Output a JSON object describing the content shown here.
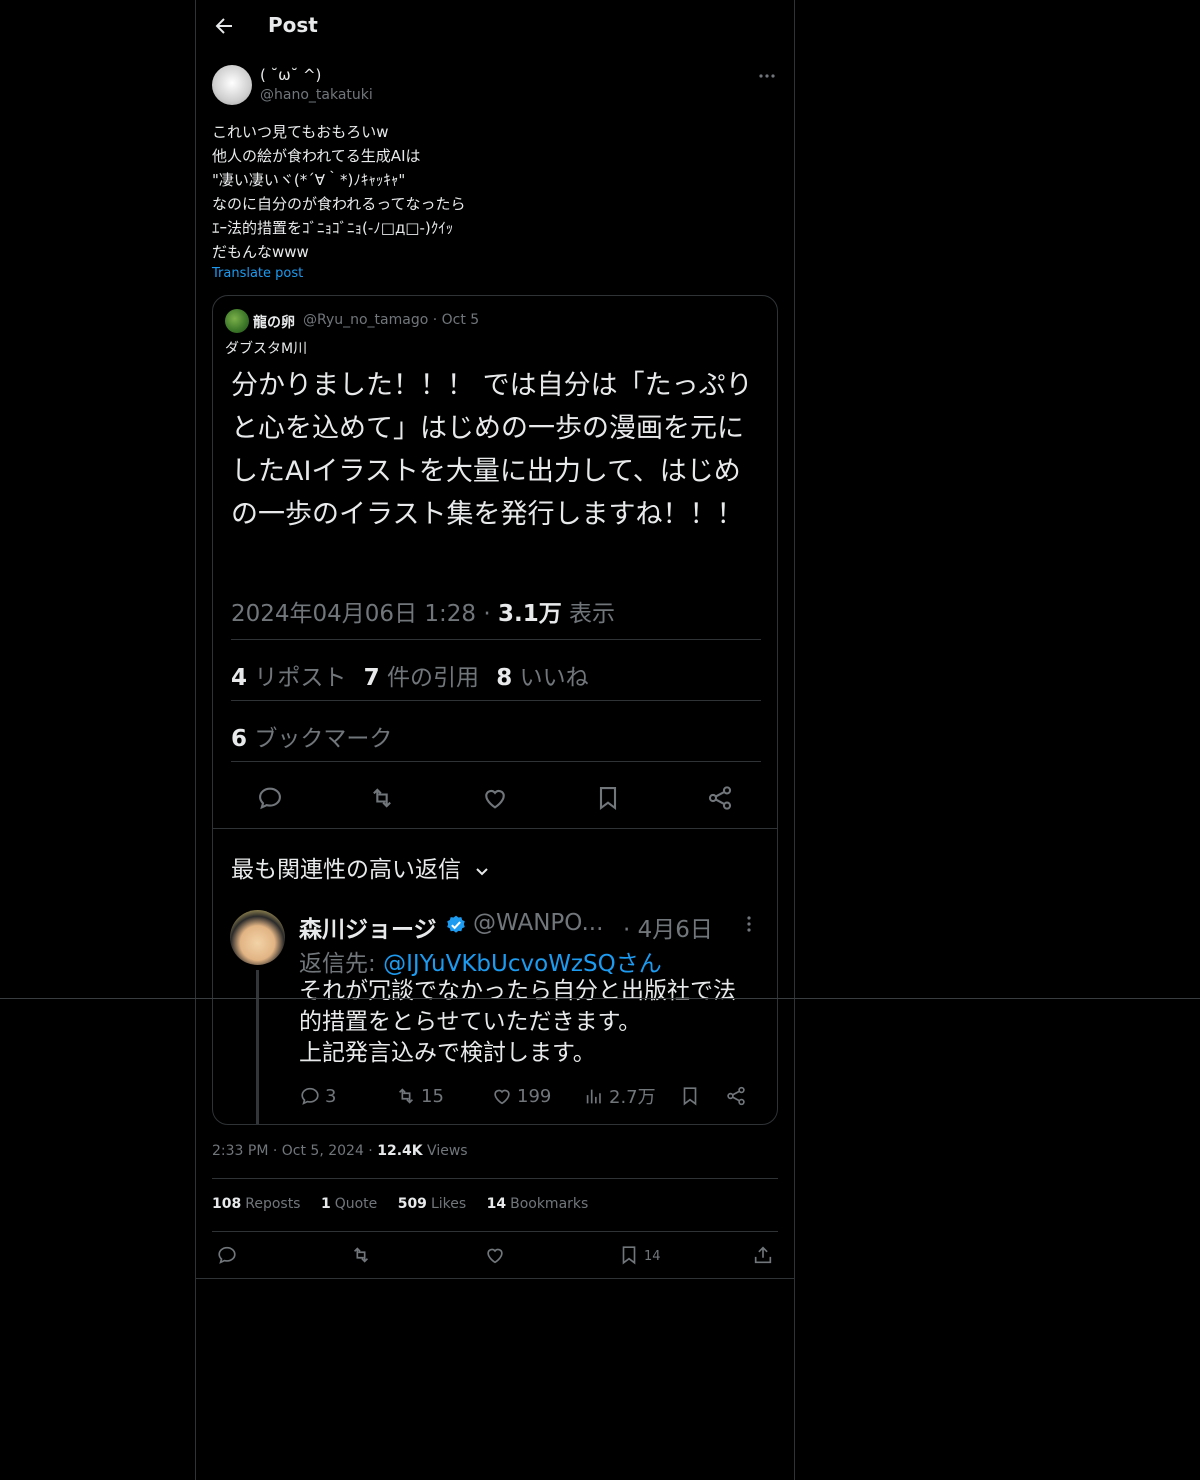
{
  "header": {
    "title": "Post"
  },
  "author": {
    "display_name": "( ˘ω˘ ^)",
    "handle": "@hano_takatuki"
  },
  "post": {
    "text": "これいつ見てもおもろいw\n他人の絵が食われてる生成AIは\n\"凄い凄いヾ(*´∀｀*)ﾉｷｬｯｷｬ\"\nなのに自分のが食われるってなったら\nｴｰ法的措置をｺﾞﾆｮｺﾞﾆｮ(-ﾉ□д□-)ｸｲｯ\nだもんなwww",
    "translate_label": "Translate post"
  },
  "quote": {
    "name": "龍の卵",
    "meta": "@Ryu_no_tamago · Oct 5",
    "text": "ダブスタM川",
    "screenshot": {
      "body": "分かりました！！！\nでは自分は「たっぷりと心を込めて」はじめの一歩の漫画を元にしたAIイラストを大量に出力して、はじめの一歩のイラスト集を発行しますね！！！",
      "timestamp": "2024年04月06日 1:28 · ",
      "views_num": "3.1万",
      "views_label": " 表示",
      "reposts_num": "4",
      "reposts_label": " リポスト",
      "quotes_num": "7",
      "quotes_label": " 件の引用",
      "likes_num": "8",
      "likes_label": " いいね",
      "bookmarks_num": "6",
      "bookmarks_label": " ブックマーク",
      "relevance_label": "最も関連性の高い返信",
      "reply": {
        "name": "森川ジョージ",
        "handle": "@WANPO...",
        "date": "· 4月6日",
        "replyto_label": "返信先: ",
        "replyto_handle": "@IJYuVKbUcvoWzSQさん",
        "text": "それが冗談でなかったら自分と出版社で法\n的措置をとらせていただきます。\n上記発言込みで検討します。",
        "replies": "3",
        "reposts": "15",
        "likes": "199",
        "views": "2.7万"
      }
    }
  },
  "timestamp": {
    "time": "2:33 PM · Oct 5, 2024 · ",
    "views_num": "12.4K",
    "views_label": " Views"
  },
  "stats": {
    "reposts_num": "108",
    "reposts_label": "Reposts",
    "quotes_num": "1",
    "quotes_label": "Quote",
    "likes_num": "509",
    "likes_label": "Likes",
    "bookmarks_num": "14",
    "bookmarks_label": "Bookmarks"
  },
  "actions": {
    "bookmark_count": "14"
  },
  "colors": {
    "background": "#000000",
    "border": "#2f3336",
    "muted": "#71767b",
    "link": "#1d9bf0",
    "text": "#e7e9ea"
  }
}
